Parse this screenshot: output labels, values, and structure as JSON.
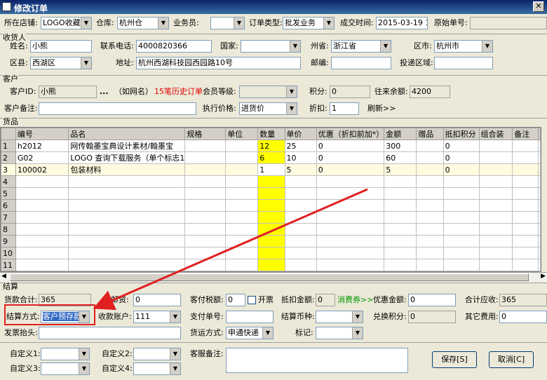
{
  "window": {
    "title": "修改订单"
  },
  "header": {
    "shop_label": "所在店铺:",
    "shop_value": "LOGO收藏家",
    "warehouse_label": "仓库:",
    "warehouse_value": "杭州仓",
    "salesman_label": "业务员:",
    "salesman_value": "",
    "order_type_label": "订单类型:",
    "order_type_value": "批发业务",
    "deal_time_label": "成交时间:",
    "deal_time_value": "2015-03-19 11:",
    "orig_no_label": "原始单号:",
    "orig_no_value": ""
  },
  "receiver": {
    "section": "收货人",
    "name_label": "姓名:",
    "name_value": "小熊",
    "phone_label": "联系电话:",
    "phone_value": "4000820366",
    "country_label": "国家:",
    "country_value": "",
    "province_label": "州省:",
    "province_value": "浙江省",
    "city_label": "区市:",
    "city_value": "杭州市",
    "district_label": "区县:",
    "district_value": "西湖区",
    "address_label": "地址:",
    "address_value": "杭州西湖科技园西园路10号",
    "zip_label": "邮编:",
    "zip_value": "",
    "area_label": "投递区域:",
    "area_value": ""
  },
  "customer": {
    "section": "客户",
    "id_label": "客户ID:",
    "id_value": "小熊",
    "dots": "...",
    "nick": "（如网名）",
    "history": "15笔历史订单",
    "level_label": "会员等级:",
    "level_value": "",
    "points_label": "积分:",
    "points_value": "0",
    "balance_label": "往来余额:",
    "balance_value": "4200",
    "remark_label": "客户备注:",
    "remark_value": "",
    "price_label": "执行价格:",
    "price_value": "进货价",
    "discount_label": "折扣:",
    "discount_value": "1",
    "refresh": "刷新>>"
  },
  "goods": {
    "section": "货品",
    "columns": [
      "编号",
      "品名",
      "规格",
      "单位",
      "数量",
      "单价",
      "优惠（折扣前加*）",
      "金额",
      "赠品",
      "抵扣积分",
      "组合装",
      "备注"
    ],
    "rows": [
      {
        "n": "1",
        "cells": [
          "h2012",
          "网传翰墨宝典设计素材/翰墨宝",
          "",
          "",
          "12",
          "25",
          "0",
          "300",
          "",
          "0",
          "",
          ""
        ]
      },
      {
        "n": "2",
        "cells": [
          "G02",
          "LOGO 查询下载服务（单个标志1",
          "",
          "",
          "6",
          "10",
          "0",
          "60",
          "",
          "0",
          "",
          ""
        ]
      },
      {
        "n": "3",
        "cells": [
          "100002",
          "包装材料",
          "",
          "",
          "1",
          "5",
          "0",
          "5",
          "",
          "0",
          "",
          ""
        ]
      },
      {
        "n": "4",
        "cells": [
          "",
          "",
          "",
          "",
          "",
          "",
          "",
          "",
          "",
          "",
          "",
          ""
        ]
      },
      {
        "n": "5",
        "cells": [
          "",
          "",
          "",
          "",
          "",
          "",
          "",
          "",
          "",
          "",
          "",
          ""
        ]
      },
      {
        "n": "6",
        "cells": [
          "",
          "",
          "",
          "",
          "",
          "",
          "",
          "",
          "",
          "",
          "",
          ""
        ]
      },
      {
        "n": "7",
        "cells": [
          "",
          "",
          "",
          "",
          "",
          "",
          "",
          "",
          "",
          "",
          "",
          ""
        ]
      },
      {
        "n": "8",
        "cells": [
          "",
          "",
          "",
          "",
          "",
          "",
          "",
          "",
          "",
          "",
          "",
          ""
        ]
      },
      {
        "n": "9",
        "cells": [
          "",
          "",
          "",
          "",
          "",
          "",
          "",
          "",
          "",
          "",
          "",
          ""
        ]
      },
      {
        "n": "10",
        "cells": [
          "",
          "",
          "",
          "",
          "",
          "",
          "",
          "",
          "",
          "",
          "",
          ""
        ]
      },
      {
        "n": "11",
        "cells": [
          "",
          "",
          "",
          "",
          "",
          "",
          "",
          "",
          "",
          "",
          "",
          ""
        ]
      }
    ]
  },
  "settle": {
    "section": "结算",
    "goods_total_label": "货款合计:",
    "goods_total_value": "365",
    "post_fee_label": "邮资:",
    "post_fee_value": "0",
    "tax_label": "客付税额:",
    "tax_value": "0",
    "invoice_label": "开票",
    "deduct_label": "抵扣金额:",
    "deduct_value": "0",
    "coupon": "消费券>>",
    "discount_amt_label": "优惠金额:",
    "discount_amt_value": "0",
    "receivable_label": "合计应收:",
    "receivable_value": "365",
    "method_label": "结算方式:",
    "method_value": "客户预存款",
    "account_label": "收款账户:",
    "account_value": "111",
    "pay_no_label": "支付单号:",
    "pay_no_value": "",
    "currency_label": "结算币种:",
    "currency_value": "",
    "exchange_label": "兑换积分:",
    "exchange_value": "0",
    "other_fee_label": "其它费用:",
    "other_fee_value": "0",
    "invoice_title_label": "发票抬头:",
    "invoice_title_value": "",
    "ship_label": "货运方式:",
    "ship_value": "申通快递",
    "mark_label": "标记:",
    "mark_value": ""
  },
  "custom": {
    "c1_label": "自定义1:",
    "c2_label": "自定义2:",
    "c3_label": "自定义3:",
    "c4_label": "自定义4:",
    "service_remark_label": "客服备注:"
  },
  "buttons": {
    "save": "保存[S]",
    "cancel": "取消[C]"
  },
  "colors": {
    "qty_highlight": "#ffff00",
    "annotation": "#e02020",
    "title_bar": "#0a246a"
  }
}
